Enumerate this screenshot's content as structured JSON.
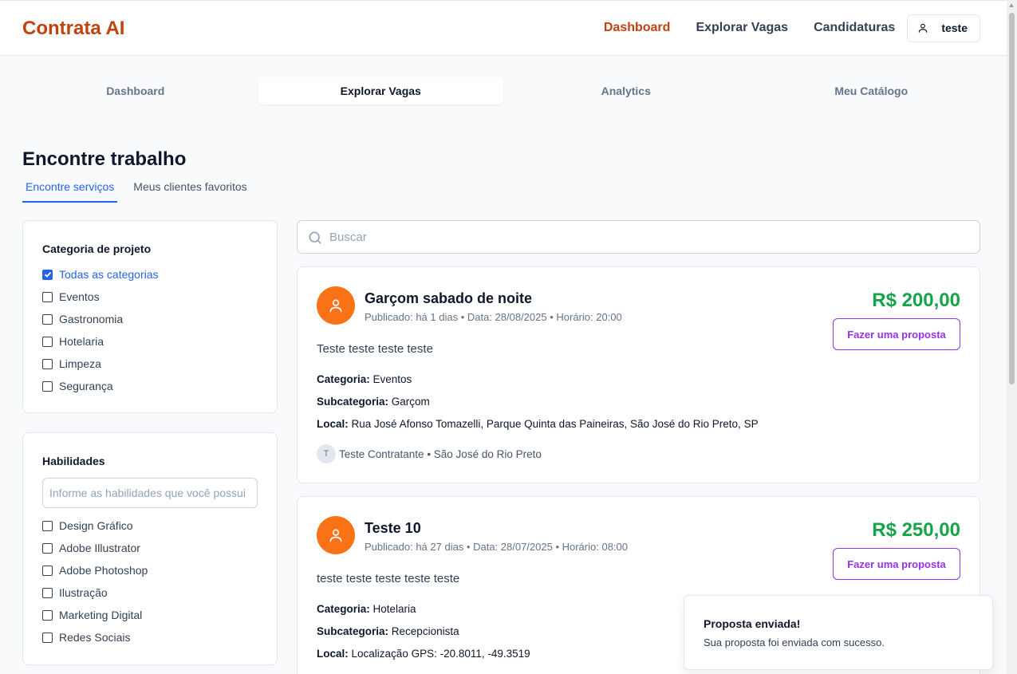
{
  "header": {
    "brand": "Contrata AI",
    "nav": [
      "Dashboard",
      "Explorar Vagas",
      "Candidaturas"
    ],
    "user": "teste"
  },
  "tabs": [
    "Dashboard",
    "Explorar Vagas",
    "Analytics",
    "Meu Catálogo"
  ],
  "page": {
    "title": "Encontre trabalho",
    "subtabs": [
      "Encontre serviços",
      "Meus clientes favoritos"
    ]
  },
  "filters": {
    "category_title": "Categoria de projeto",
    "categories": [
      "Todas as categorias",
      "Eventos",
      "Gastronomia",
      "Hotelaria",
      "Limpeza",
      "Segurança"
    ],
    "skills_title": "Habilidades",
    "skills_placeholder": "Informe as habilidades que você possui",
    "skills": [
      "Design Gráfico",
      "Adobe Illustrator",
      "Adobe Photoshop",
      "Ilustração",
      "Marketing Digital",
      "Redes Sociais"
    ]
  },
  "search": {
    "placeholder": "Buscar"
  },
  "labels": {
    "category": "Categoria:",
    "subcategory": "Subcategoria:",
    "location": "Local:",
    "propose": "Fazer uma proposta"
  },
  "jobs": [
    {
      "title": "Garçom sabado de noite",
      "meta": "Publicado: há 1 dias • Data: 28/08/2025 • Horário: 20:00",
      "price": "R$ 200,00",
      "description": "Teste teste teste teste",
      "category": "Eventos",
      "subcategory": "Garçom",
      "location": "Rua José Afonso Tomazelli, Parque Quinta das Paineiras, São José do Rio Preto, SP",
      "poster_initial": "T",
      "poster": "Teste Contratante • São José do Rio Preto"
    },
    {
      "title": "Teste 10",
      "meta": "Publicado: há 27 dias • Data: 28/07/2025 • Horário: 08:00",
      "price": "R$ 250,00",
      "description": "teste teste teste teste teste",
      "category": "Hotelaria",
      "subcategory": "Recepcionista",
      "location": "Localização GPS: -20.8011, -49.3519"
    }
  ],
  "toast": {
    "title": "Proposta enviada!",
    "message": "Sua proposta foi enviada com sucesso."
  },
  "colors": {
    "brand": "#c2410c",
    "price": "#16a34a",
    "propose": "#9333ea",
    "accent": "#2563eb",
    "avatar": "#f97316"
  }
}
